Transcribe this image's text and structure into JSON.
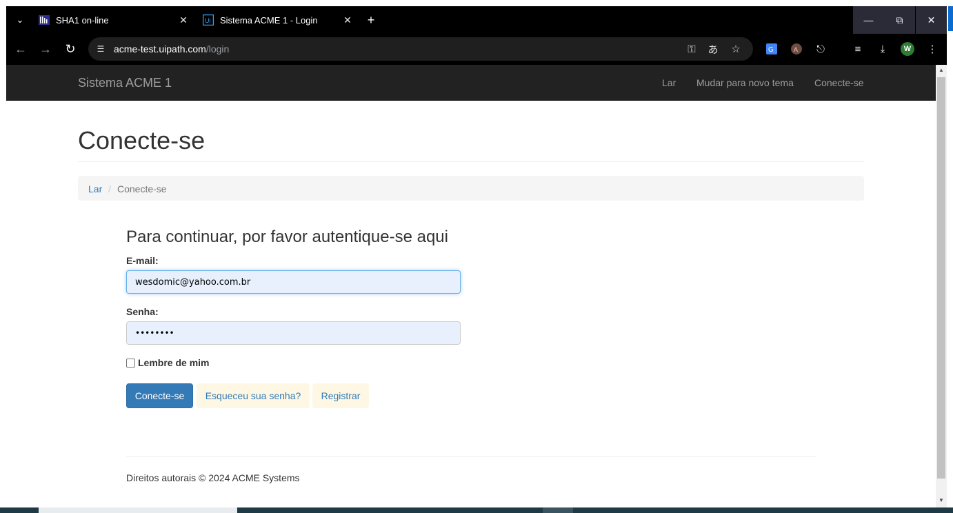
{
  "browser": {
    "tabs": [
      {
        "title": "SHA1 on-line",
        "favicon": "sha1-site-icon",
        "active": false
      },
      {
        "title": "Sistema ACME 1 - Login",
        "favicon": "uipath-icon",
        "active": true
      }
    ],
    "url_host": "acme-test.uipath.com",
    "url_path": "/login",
    "profile_initial": "W",
    "colors": {
      "chrome_bg": "#000000",
      "omnibox_bg": "#1f1f1f",
      "profile": "#2e7d32",
      "accent": "#0a6cd0"
    }
  },
  "navbar": {
    "brand": "Sistema ACME 1",
    "links": [
      "Lar",
      "Mudar para novo tema",
      "Conecte-se"
    ],
    "bg": "#222222"
  },
  "page": {
    "title": "Conecte-se",
    "breadcrumb": {
      "home": "Lar",
      "separator": "/",
      "current": "Conecte-se"
    },
    "form": {
      "heading": "Para continuar, por favor autentique-se aqui",
      "email_label": "E-mail:",
      "email_value": "wesdomic@yahoo.com.br",
      "password_label": "Senha:",
      "password_value": "••••••••",
      "remember_label": "Lembre de mim",
      "remember_checked": false,
      "login_button": "Conecte-se",
      "forgot_button": "Esqueceu sua senha?",
      "register_button": "Registrar"
    },
    "footer": "Direitos autorais © 2024 ACME Systems",
    "colors": {
      "primary": "#337ab7",
      "link_btn_bg": "#fdf7e3",
      "autofill_bg": "#e8f0fe"
    }
  }
}
